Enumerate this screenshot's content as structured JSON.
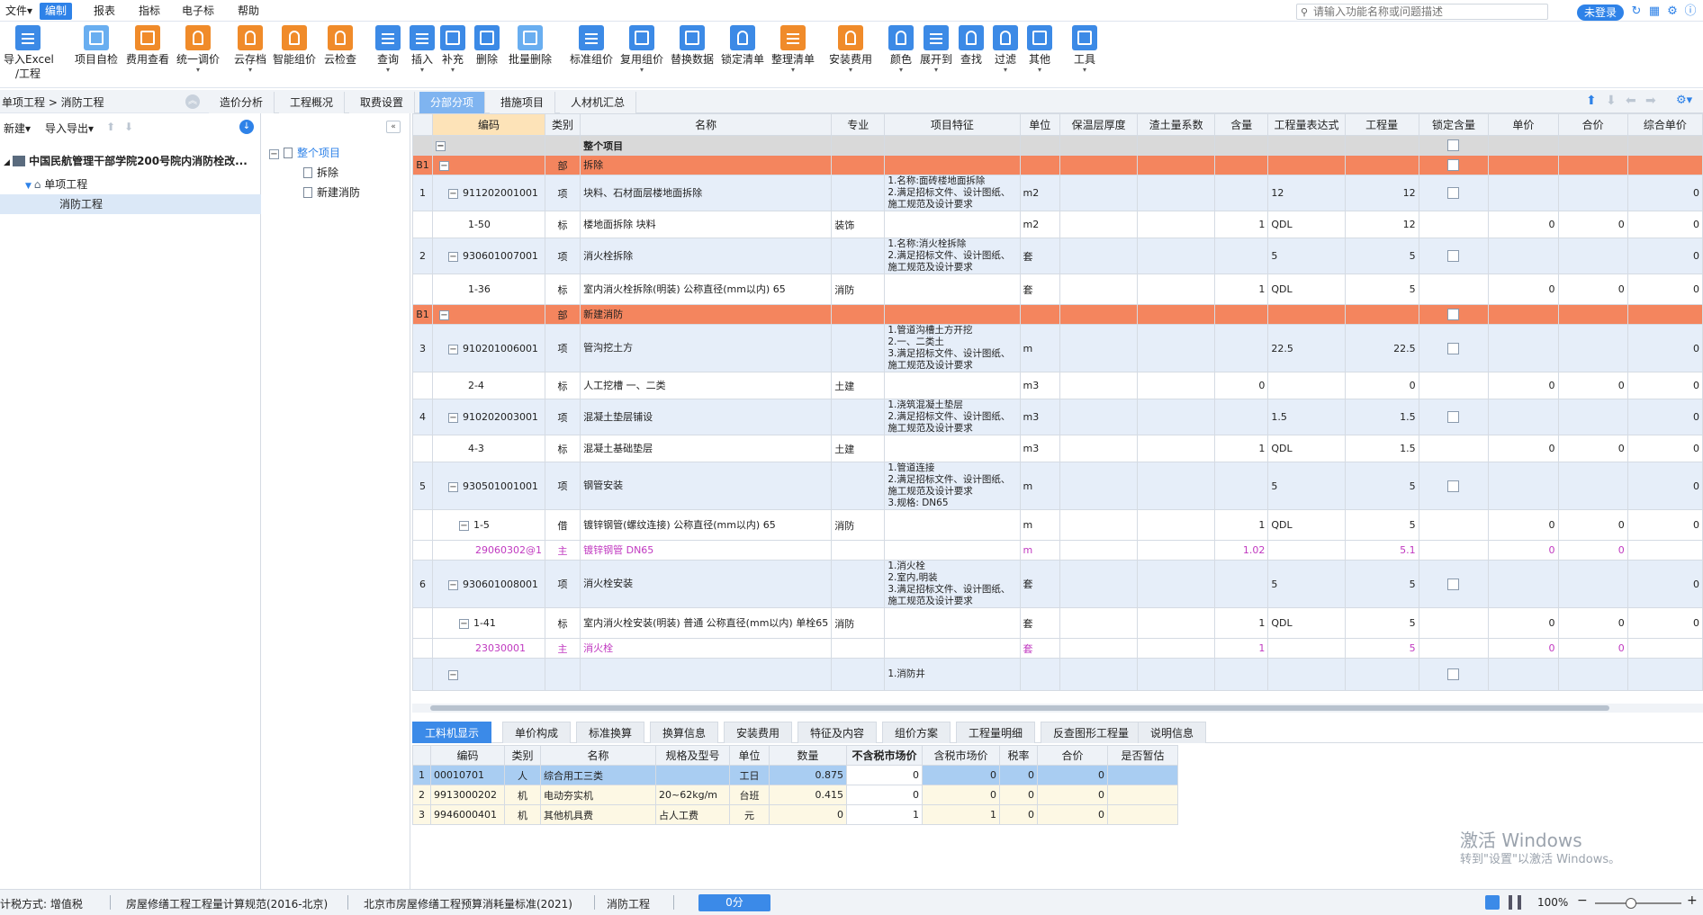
{
  "menubar": {
    "items": [
      "文件▾",
      "编制",
      "报表",
      "指标",
      "电子标",
      "帮助"
    ],
    "search_placeholder": "请输入功能名称或问题描述",
    "login": "未登录"
  },
  "ribbon": {
    "buttons": [
      {
        "label": "导入Excel",
        "label2": "/工程",
        "icon": "excel-import-icon",
        "color": "blue"
      },
      {
        "label": "项目自检",
        "icon": "check-doc-icon",
        "color": "blue"
      },
      {
        "label": "费用查看",
        "icon": "cost-view-icon",
        "color": "orange"
      },
      {
        "label": "统一调价",
        "icon": "price-adjust-icon",
        "color": "orange"
      },
      {
        "label": "云存档",
        "icon": "cloud-save-icon",
        "color": "orange"
      },
      {
        "label": "智能组价",
        "icon": "smart-price-icon",
        "color": "orange"
      },
      {
        "label": "云检查",
        "icon": "cloud-check-icon",
        "color": "orange"
      },
      {
        "label": "查询",
        "icon": "query-icon",
        "color": "blue"
      },
      {
        "label": "插入",
        "icon": "insert-icon",
        "color": "blue"
      },
      {
        "label": "补充",
        "icon": "supplement-icon",
        "color": "blue"
      },
      {
        "label": "删除",
        "icon": "delete-icon",
        "color": "blue"
      },
      {
        "label": "批量删除",
        "icon": "batch-delete-icon",
        "color": "blue"
      },
      {
        "label": "标准组价",
        "icon": "standard-price-icon",
        "color": "blue"
      },
      {
        "label": "复用组价",
        "icon": "reuse-price-icon",
        "color": "blue"
      },
      {
        "label": "替换数据",
        "icon": "replace-data-icon",
        "color": "blue"
      },
      {
        "label": "锁定清单",
        "icon": "lock-list-icon",
        "color": "blue"
      },
      {
        "label": "整理清单",
        "icon": "organize-list-icon",
        "color": "orange"
      },
      {
        "label": "安装费用",
        "icon": "install-cost-icon",
        "color": "orange"
      },
      {
        "label": "颜色",
        "icon": "color-icon",
        "color": "blue"
      },
      {
        "label": "展开到",
        "icon": "expand-to-icon",
        "color": "blue"
      },
      {
        "label": "查找",
        "icon": "find-icon",
        "color": "blue"
      },
      {
        "label": "过滤",
        "icon": "filter-icon",
        "color": "blue"
      },
      {
        "label": "其他",
        "icon": "other-icon",
        "color": "blue"
      },
      {
        "label": "工具",
        "icon": "tools-icon",
        "color": "blue"
      }
    ]
  },
  "leftpanel": {
    "breadcrumb": "单项工程 > 消防工程",
    "new_label": "新建▾",
    "import_label": "导入导出▾",
    "project_name": "中国民航管理干部学院200号院内消防栓改...",
    "single_label": "单项工程",
    "fire_label": "消防工程"
  },
  "midtree": {
    "root": "整个项目",
    "child1": "拆除",
    "child2": "新建消防"
  },
  "tabs": [
    "造价分析",
    "工程概况",
    "取费设置",
    "分部分项",
    "措施项目",
    "人材机汇总"
  ],
  "grid": {
    "headers": [
      "编码",
      "类别",
      "名称",
      "专业",
      "项目特征",
      "单位",
      "保温层厚度",
      "渣土量系数",
      "含量",
      "工程量表达式",
      "工程量",
      "锁定含量",
      "单价",
      "合价",
      "综合单价"
    ],
    "whole_row": "整个项目",
    "rows": [
      {
        "type": "bu",
        "idx": "B1",
        "code": "",
        "cat": "部",
        "name": "拆除",
        "spec": "",
        "feat": "",
        "unit": "",
        "qty": "",
        "expr": "",
        "amount": "",
        "price": "",
        "total": "",
        "comp": ""
      },
      {
        "type": "xiang",
        "idx": "1",
        "code": "911202001001",
        "cat": "项",
        "name": "块料、石材面层楼地面拆除",
        "spec": "",
        "feat": "1.名称:面砖楼地面拆除\n2.满足招标文件、设计图纸、施工规范及设计要求",
        "unit": "m2",
        "qty": "",
        "expr": "12",
        "amount": "12",
        "price": "",
        "total": "",
        "comp": "0"
      },
      {
        "type": "child",
        "idx": "",
        "code": "1-50",
        "cat": "标",
        "name": "楼地面拆除 块料",
        "spec": "装饰",
        "feat": "",
        "unit": "m2",
        "qty": "1",
        "expr": "QDL",
        "amount": "12",
        "price": "0",
        "total": "0",
        "comp": "0"
      },
      {
        "type": "xiang",
        "idx": "2",
        "code": "930601007001",
        "cat": "项",
        "name": "消火栓拆除",
        "spec": "",
        "feat": "1.名称:消火栓拆除\n2.满足招标文件、设计图纸、施工规范及设计要求",
        "unit": "套",
        "qty": "",
        "expr": "5",
        "amount": "5",
        "price": "",
        "total": "",
        "comp": "0"
      },
      {
        "type": "child",
        "idx": "",
        "code": "1-36",
        "cat": "标",
        "name": "室内消火栓拆除(明装) 公称直径(mm以内) 65",
        "spec": "消防",
        "feat": "",
        "unit": "套",
        "qty": "1",
        "expr": "QDL",
        "amount": "5",
        "price": "0",
        "total": "0",
        "comp": "0"
      },
      {
        "type": "bu",
        "idx": "B1",
        "code": "",
        "cat": "部",
        "name": "新建消防",
        "spec": "",
        "feat": "",
        "unit": "",
        "qty": "",
        "expr": "",
        "amount": "",
        "price": "",
        "total": "",
        "comp": ""
      },
      {
        "type": "xiang",
        "idx": "3",
        "code": "910201006001",
        "cat": "项",
        "name": "管沟挖土方",
        "spec": "",
        "feat": "1.管道沟槽土方开挖\n2.一、二类土\n3.满足招标文件、设计图纸、施工规范及设计要求",
        "unit": "m",
        "qty": "",
        "expr": "22.5",
        "amount": "22.5",
        "price": "",
        "total": "",
        "comp": "0"
      },
      {
        "type": "child",
        "idx": "",
        "code": "2-4",
        "cat": "标",
        "name": "人工挖槽 一、二类",
        "spec": "土建",
        "feat": "",
        "unit": "m3",
        "qty": "0",
        "expr": "",
        "amount": "0",
        "price": "0",
        "total": "0",
        "comp": "0"
      },
      {
        "type": "xiang",
        "idx": "4",
        "code": "910202003001",
        "cat": "项",
        "name": "混凝土垫层铺设",
        "spec": "",
        "feat": "1.浇筑混凝土垫层\n2.满足招标文件、设计图纸、施工规范及设计要求",
        "unit": "m3",
        "qty": "",
        "expr": "1.5",
        "amount": "1.5",
        "price": "",
        "total": "",
        "comp": "0"
      },
      {
        "type": "child",
        "idx": "",
        "code": "4-3",
        "cat": "标",
        "name": "混凝土基础垫层",
        "spec": "土建",
        "feat": "",
        "unit": "m3",
        "qty": "1",
        "expr": "QDL",
        "amount": "1.5",
        "price": "0",
        "total": "0",
        "comp": "0"
      },
      {
        "type": "xiang",
        "idx": "5",
        "code": "930501001001",
        "cat": "项",
        "name": "钢管安装",
        "spec": "",
        "feat": "1.管道连接\n2.满足招标文件、设计图纸、施工规范及设计要求\n3.规格: DN65",
        "unit": "m",
        "qty": "",
        "expr": "5",
        "amount": "5",
        "price": "",
        "total": "",
        "comp": "0"
      },
      {
        "type": "child",
        "idx": "",
        "code": "1-5",
        "cat": "借",
        "name": "镀锌钢管(螺纹连接) 公称直径(mm以内) 65",
        "spec": "消防",
        "feat": "",
        "unit": "m",
        "qty": "1",
        "expr": "QDL",
        "amount": "5",
        "price": "0",
        "total": "0",
        "comp": "0"
      },
      {
        "type": "main",
        "idx": "",
        "code": "29060302@1",
        "cat": "主",
        "name": "镀锌钢管 DN65",
        "spec": "",
        "feat": "",
        "unit": "m",
        "qty": "1.02",
        "expr": "",
        "amount": "5.1",
        "price": "0",
        "total": "0",
        "comp": ""
      },
      {
        "type": "xiang",
        "idx": "6",
        "code": "930601008001",
        "cat": "项",
        "name": "消火栓安装",
        "spec": "",
        "feat": "1.消火栓\n2.室内,明装\n3.满足招标文件、设计图纸、施工规范及设计要求",
        "unit": "套",
        "qty": "",
        "expr": "5",
        "amount": "5",
        "price": "",
        "total": "",
        "comp": "0"
      },
      {
        "type": "child",
        "idx": "",
        "code": "1-41",
        "cat": "标",
        "name": "室内消火栓安装(明装) 普通 公称直径(mm以内) 单栓65",
        "spec": "消防",
        "feat": "",
        "unit": "套",
        "qty": "1",
        "expr": "QDL",
        "amount": "5",
        "price": "0",
        "total": "0",
        "comp": "0"
      },
      {
        "type": "main",
        "idx": "",
        "code": "23030001",
        "cat": "主",
        "name": "消火栓",
        "spec": "",
        "feat": "",
        "unit": "套",
        "qty": "1",
        "expr": "",
        "amount": "5",
        "price": "0",
        "total": "0",
        "comp": ""
      },
      {
        "type": "xiang",
        "idx": "",
        "code": "",
        "cat": "",
        "name": "",
        "spec": "",
        "feat": "1.消防井",
        "unit": "",
        "qty": "",
        "expr": "",
        "amount": "",
        "price": "",
        "total": "",
        "comp": ""
      }
    ]
  },
  "bottom_tabs": [
    "工料机显示",
    "单价构成",
    "标准换算",
    "换算信息",
    "安装费用",
    "特征及内容",
    "组价方案",
    "工程量明细",
    "反查图形工程量",
    "说明信息"
  ],
  "bgrid": {
    "headers": [
      "编码",
      "类别",
      "名称",
      "规格及型号",
      "单位",
      "数量",
      "不含税市场价",
      "含税市场价",
      "税率",
      "合价",
      "是否暂估"
    ],
    "rows": [
      {
        "i": "1",
        "code": "00010701",
        "cat": "人",
        "name": "综合用工三类",
        "spec": "",
        "unit": "工日",
        "qty": "0.875",
        "p1": "0",
        "p2": "0",
        "tax": "0",
        "total": "0"
      },
      {
        "i": "2",
        "code": "9913000202",
        "cat": "机",
        "name": "电动夯实机",
        "spec": "20~62kg/m",
        "unit": "台班",
        "qty": "0.415",
        "p1": "0",
        "p2": "0",
        "tax": "0",
        "total": "0"
      },
      {
        "i": "3",
        "code": "9946000401",
        "cat": "机",
        "name": "其他机具费",
        "spec": "占人工费",
        "unit": "元",
        "qty": "0",
        "p1": "1",
        "p2": "1",
        "tax": "0",
        "total": "0"
      }
    ]
  },
  "watermark": {
    "line1": "激活 Windows",
    "line2": "转到\"设置\"以激活 Windows。"
  },
  "status": {
    "tax": "计税方式: 增值税",
    "spec1": "房屋修缮工程工程量计算规范(2016-北京)",
    "spec2": "北京市房屋修缮工程预算消耗量标准(2021)",
    "project": "消防工程",
    "zero": "0分",
    "zoom": "100%"
  },
  "colors": {
    "accent": "#2e82e8",
    "bu_row": "#f4855e",
    "main_text": "#c039c0",
    "tab_active": "#7fb4f0"
  }
}
